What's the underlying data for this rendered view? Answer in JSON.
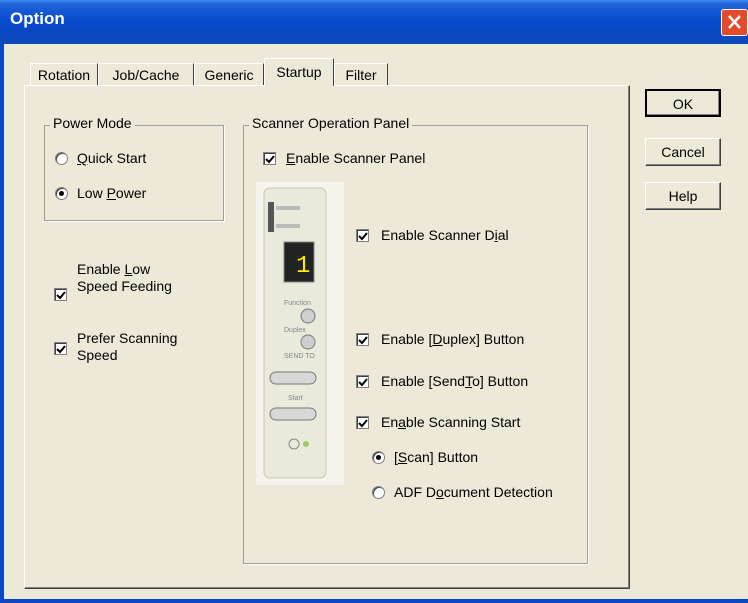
{
  "window": {
    "title": "Option"
  },
  "tabs": [
    {
      "label": "Rotation"
    },
    {
      "label": "Job/Cache"
    },
    {
      "label": "Generic"
    },
    {
      "label": "Startup"
    },
    {
      "label": "Filter"
    }
  ],
  "power_mode": {
    "legend": "Power Mode",
    "options": [
      {
        "label": "Quick Start",
        "selected": false
      },
      {
        "label": "Low Power",
        "selected": true
      }
    ]
  },
  "left_checks": [
    {
      "line1": "Enable Low",
      "line2": "Speed Feeding",
      "checked": true
    },
    {
      "line1": "Prefer Scanning",
      "line2": "Speed",
      "checked": true
    }
  ],
  "scanner_panel": {
    "legend": "Scanner Operation Panel",
    "enable_panel": "Enable Scanner Panel",
    "enable_dial": "Enable Scanner Dial",
    "enable_duplex": "Enable [Duplex] Button",
    "enable_sendto": "Enable [SendTo] Button",
    "enable_start": "Enable Scanning Start",
    "start_options": [
      {
        "label": "[Scan] Button",
        "selected": true
      },
      {
        "label": "ADF Document Detection",
        "selected": false
      }
    ],
    "device": {
      "display_digit": "1",
      "labels": [
        "Function",
        "Duplex",
        "SEND TO",
        "Start"
      ]
    }
  },
  "buttons": {
    "ok": "OK",
    "cancel": "Cancel",
    "help": "Help"
  }
}
